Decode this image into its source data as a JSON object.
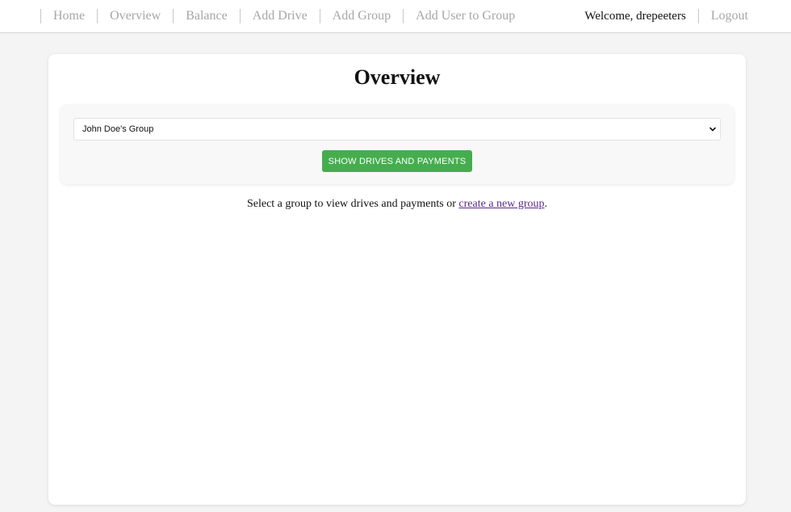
{
  "nav": {
    "items": [
      {
        "label": "Home"
      },
      {
        "label": "Overview"
      },
      {
        "label": "Balance"
      },
      {
        "label": "Add Drive"
      },
      {
        "label": "Add Group"
      },
      {
        "label": "Add User to Group"
      }
    ],
    "welcome": "Welcome, drepeeters",
    "logout": "Logout"
  },
  "main": {
    "title": "Overview",
    "group_select": {
      "selected": "John Doe's Group"
    },
    "show_button": "SHOW DRIVES AND PAYMENTS",
    "info": {
      "prefix": "Select a group to view drives and payments or ",
      "link": "create a new group",
      "suffix": "."
    }
  },
  "colors": {
    "button": "#46ad4f",
    "link": "#5a2a85",
    "nav_text": "#a6a6a6"
  }
}
